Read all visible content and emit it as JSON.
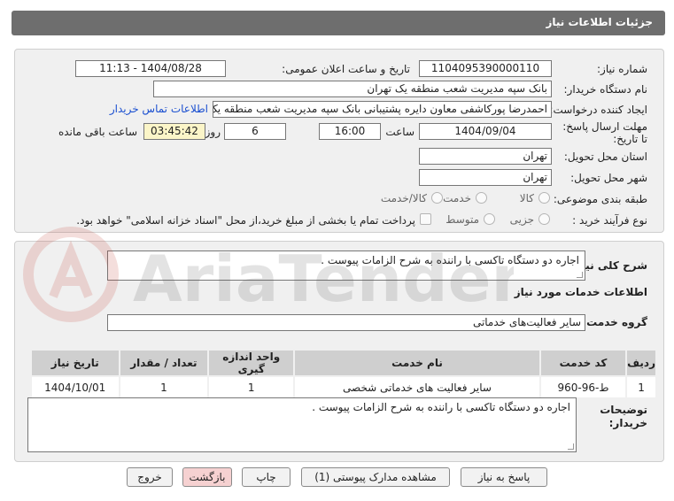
{
  "header": {
    "title": "جزئیات اطلاعات نیاز"
  },
  "fields": {
    "need_number_label": "شماره نیاز:",
    "need_number": "1104095390000110",
    "announce_label": "تاریخ و ساعت اعلان عمومی:",
    "announce_value": "1404/08/28 - 11:13",
    "buyer_label": "نام دستگاه خریدار:",
    "buyer_value": "بانک سپه مدیریت شعب منطقه یک تهران",
    "creator_label": "ایجاد کننده درخواست:",
    "creator_value": "احمدرضا پورکاشفی معاون دایره پشتیبانی بانک سپه مدیریت شعب منطقه یک تهران",
    "contact_link": "اطلاعات تماس خریدار",
    "deadline_label": "مهلت ارسال پاسخ: تا تاریخ:",
    "deadline_date": "1404/09/04",
    "time_label": "ساعت",
    "deadline_time": "16:00",
    "days_value": "6",
    "days_label": "روز و",
    "remaining_time": "03:45:42",
    "remaining_label": "ساعت باقی مانده",
    "province_label": "استان محل تحویل:",
    "province_value": "تهران",
    "city_label": "شهر محل تحویل:",
    "city_value": "تهران",
    "category_label": "طبقه بندی موضوعی:",
    "category_options": [
      "کالا",
      "خدمت",
      "کالا/خدمت"
    ],
    "purchase_label": "نوع فرآیند خرید :",
    "purchase_options": [
      "جزیی",
      "متوسط"
    ],
    "payment_note": "پرداخت تمام یا بخشی از مبلغ خرید،از محل \"اسناد خزانه اسلامی\" خواهد بود."
  },
  "details": {
    "general_desc_label": "شرح کلی نیاز:",
    "general_desc": "اجاره دو دستگاه تاکسی با راننده به شرح الزامات پیوست .",
    "services_heading": "اطلاعات خدمات مورد نیاز",
    "service_group_label": "گروه خدمت:",
    "service_group": "سایر فعالیت‌های خدماتی",
    "table": {
      "headers": [
        "ردیف",
        "کد خدمت",
        "نام خدمت",
        "واحد اندازه گیری",
        "تعداد / مقدار",
        "تاریخ نیاز"
      ],
      "rows": [
        [
          "1",
          "ط-96-960",
          "سایر فعالیت های خدماتی شخصی",
          "1",
          "1",
          "1404/10/01"
        ]
      ]
    },
    "buyer_notes_label": "توضیحات خریدار:",
    "buyer_notes": "اجاره دو دستگاه تاکسی با راننده به شرح الزامات پیوست ."
  },
  "buttons": {
    "reply": "پاسخ به نیاز",
    "attachments": "مشاهده مدارک پیوستی (1)",
    "print": "چاپ",
    "back": "بازگشت",
    "exit": "خروج"
  },
  "watermark": {
    "text": "AriaTender.net"
  }
}
